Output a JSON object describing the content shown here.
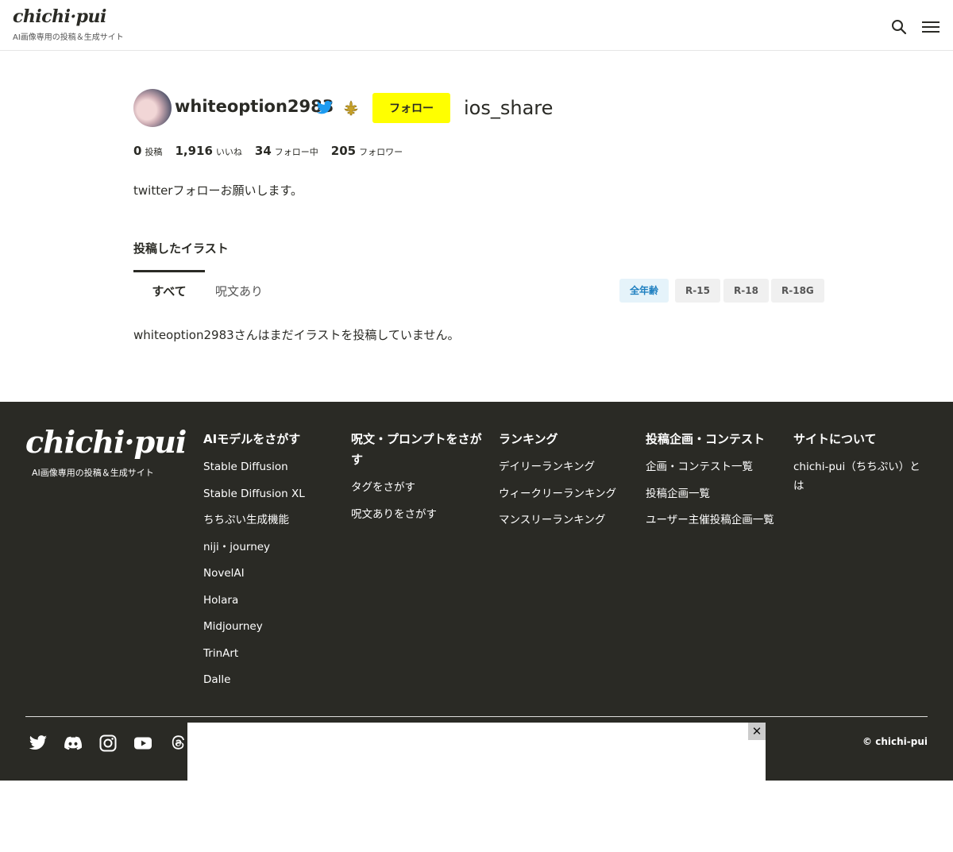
{
  "header": {
    "logo": "chichi·pui",
    "tagline": "AI画像専用の投稿＆生成サイト"
  },
  "profile": {
    "username": "whiteoption2983",
    "follow_label": "フォロー",
    "share_label": "ios_share",
    "stats": [
      {
        "value": "0",
        "label": "投稿"
      },
      {
        "value": "1,916",
        "label": "いいね"
      },
      {
        "value": "34",
        "label": "フォロー中"
      },
      {
        "value": "205",
        "label": "フォロワー"
      }
    ],
    "bio": "twitterフォローお願いします。"
  },
  "illustrations": {
    "title": "投稿したイラスト",
    "tabs": [
      "すべて",
      "呪文あり"
    ],
    "ratings": [
      "全年齢",
      "R-15",
      "R-18",
      "R-18G"
    ],
    "empty_message": "whiteoption2983さんはまだイラストを投稿していません。"
  },
  "footer": {
    "logo": "chichi·pui",
    "tagline": "AI画像専用の投稿＆生成サイト",
    "columns": [
      {
        "title": "AIモデルをさがす",
        "links": [
          "Stable Diffusion",
          "Stable Diffusion XL",
          "ちちぷい生成機能",
          "niji・journey",
          "NovelAI",
          "Holara",
          "Midjourney",
          "TrinArt",
          "Dalle"
        ]
      },
      {
        "title": "呪文・プロンプトをさがす",
        "links": [
          "タグをさがす",
          "呪文ありをさがす"
        ]
      },
      {
        "title": "ランキング",
        "links": [
          "デイリーランキング",
          "ウィークリーランキング",
          "マンスリーランキング"
        ]
      },
      {
        "title": "投稿企画・コンテスト",
        "links": [
          "企画・コンテスト一覧",
          "投稿企画一覧",
          "ユーザー主催投稿企画一覧"
        ]
      },
      {
        "title": "サイトについて",
        "links": [
          "chichi-pui（ちちぷい）とは"
        ]
      }
    ],
    "copyright": "© chichi-pui"
  },
  "ad": {
    "close_label": "✕"
  },
  "colors": {
    "accent_yellow": "#ffff00",
    "footer_bg": "#2a2a25",
    "rating_active_bg": "#e5f3fa",
    "rating_active_text": "#1d7fc0"
  }
}
